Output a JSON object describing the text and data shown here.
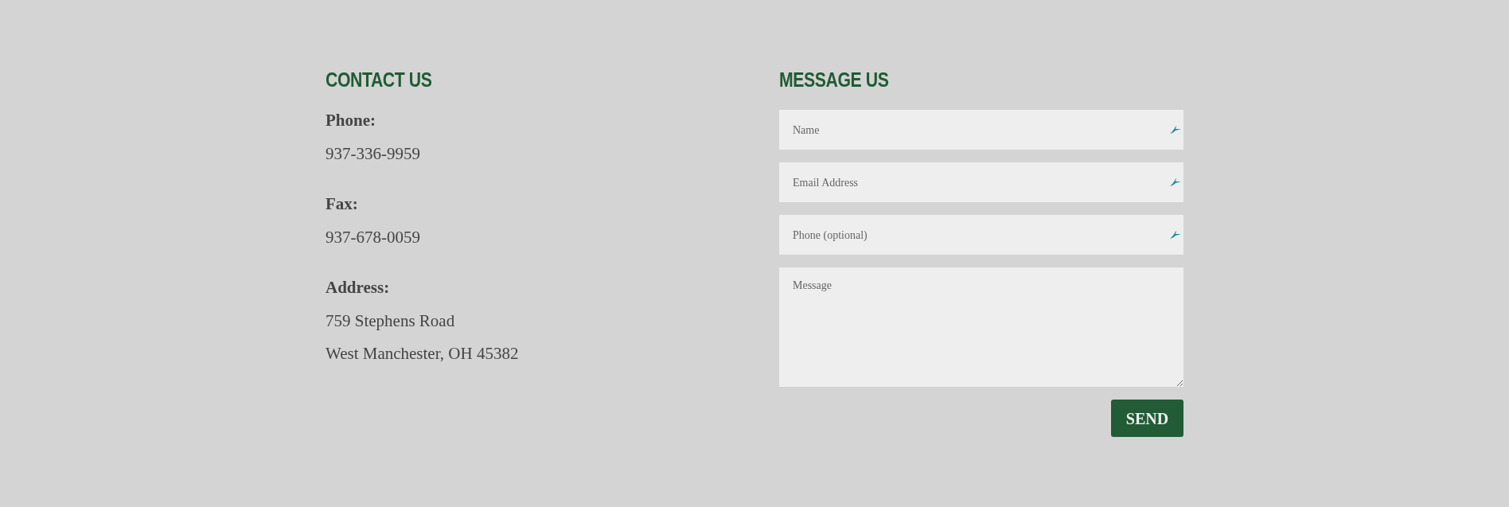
{
  "contact": {
    "title": "CONTACT US",
    "groups": [
      {
        "label": "Phone:",
        "lines": [
          "937-336-9959"
        ]
      },
      {
        "label": "Fax:",
        "lines": [
          "937-678-0059"
        ]
      },
      {
        "label": "Address:",
        "lines": [
          "759 Stephens Road",
          "West Manchester, OH 45382"
        ]
      }
    ]
  },
  "message": {
    "title": "MESSAGE US",
    "fields": [
      {
        "kind": "input",
        "placeholder": "Name",
        "icon": true
      },
      {
        "kind": "input",
        "placeholder": "Email Address",
        "icon": true
      },
      {
        "kind": "input",
        "placeholder": "Phone (optional)",
        "icon": true
      },
      {
        "kind": "textarea",
        "placeholder": "Message",
        "icon": false
      }
    ],
    "button": "SEND"
  }
}
